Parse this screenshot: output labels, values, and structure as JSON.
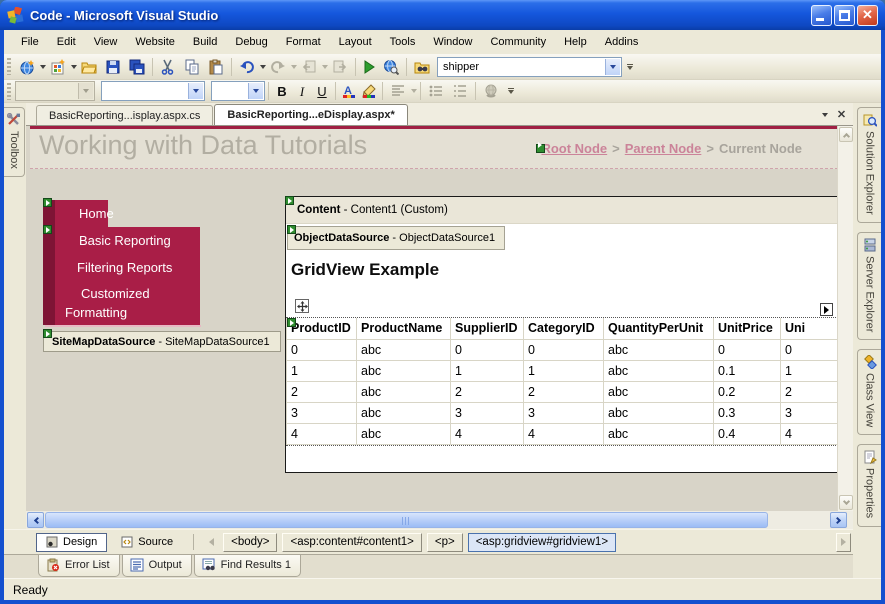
{
  "window": {
    "title": "Code - Microsoft Visual Studio"
  },
  "menu": {
    "items": [
      "File",
      "Edit",
      "View",
      "Website",
      "Build",
      "Debug",
      "Format",
      "Layout",
      "Tools",
      "Window",
      "Community",
      "Help",
      "Addins"
    ]
  },
  "standard_toolbar": {
    "find_combo_value": "shipper"
  },
  "formatting_toolbar": {
    "bold": "B",
    "italic": "I",
    "underline": "U"
  },
  "document_tabs": [
    {
      "label": "BasicReporting...isplay.aspx.cs"
    },
    {
      "label": "BasicReporting...eDisplay.aspx*"
    }
  ],
  "toolbox": {
    "label": "Toolbox"
  },
  "side_tabs": {
    "solution_explorer": "Solution Explorer",
    "server_explorer": "Server Explorer",
    "class_view": "Class View",
    "properties": "Properties"
  },
  "designer": {
    "page_title": "Working with Data Tutorials",
    "breadcrumb": {
      "root": "Root Node",
      "sep1": ">",
      "parent": "Parent Node",
      "sep2": ">",
      "current": "Current Node"
    },
    "nav": {
      "home": "Home",
      "item1": "Basic Reporting",
      "item2": "Filtering Reports",
      "item3": "Customized Formatting"
    },
    "sitemap_ds": {
      "bold": "SiteMapDataSource",
      "rest": " - SiteMapDataSource1"
    },
    "content_panel": {
      "bold": "Content",
      "rest": " - Content1 (Custom)"
    },
    "object_ds": {
      "bold": "ObjectDataSource",
      "rest": " - ObjectDataSource1"
    },
    "gridview": {
      "title": "GridView Example",
      "columns": [
        "ProductID",
        "ProductName",
        "SupplierID",
        "CategoryID",
        "QuantityPerUnit",
        "UnitPrice",
        "Uni"
      ],
      "rows": [
        [
          "0",
          "abc",
          "0",
          "0",
          "abc",
          "0",
          "0"
        ],
        [
          "1",
          "abc",
          "1",
          "1",
          "abc",
          "0.1",
          "1"
        ],
        [
          "2",
          "abc",
          "2",
          "2",
          "abc",
          "0.2",
          "2"
        ],
        [
          "3",
          "abc",
          "3",
          "3",
          "abc",
          "0.3",
          "3"
        ],
        [
          "4",
          "abc",
          "4",
          "4",
          "abc",
          "0.4",
          "4"
        ]
      ]
    }
  },
  "view_bar": {
    "design": "Design",
    "source": "Source",
    "tags": [
      "<body>",
      "<asp:content#content1>",
      "<p>",
      "<asp:gridview#gridview1>"
    ]
  },
  "panel_tabs": {
    "error_list": "Error List",
    "output": "Output",
    "find_results": "Find Results 1"
  },
  "status_bar": {
    "text": "Ready"
  },
  "colors": {
    "accent_red": "#a91e47",
    "nav_dark": "#7e1435",
    "link_pink": "#cb8399",
    "titlebar_blue": "#1557dd"
  }
}
